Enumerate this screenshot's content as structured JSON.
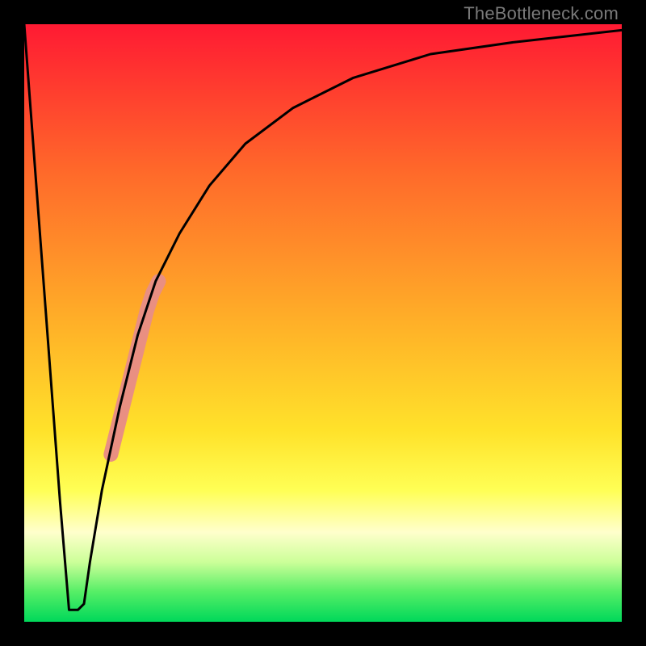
{
  "watermark": "TheBottleneck.com",
  "chart_data": {
    "type": "line",
    "title": "",
    "xlabel": "",
    "ylabel": "",
    "xlim": [
      0,
      100
    ],
    "ylim": [
      0,
      100
    ],
    "series": [
      {
        "name": "bottleneck-curve",
        "x": [
          0,
          3,
          6,
          7.5,
          9,
          10,
          11,
          13,
          16,
          19,
          22,
          26,
          31,
          37,
          45,
          55,
          68,
          82,
          100
        ],
        "values": [
          100,
          60,
          20,
          2,
          2,
          3,
          10,
          22,
          36,
          48,
          57,
          65,
          73,
          80,
          86,
          91,
          95,
          97,
          99
        ]
      }
    ],
    "highlight_segment": {
      "name": "marker-band",
      "x": [
        14.5,
        15.5,
        16.5,
        17.5,
        18.5,
        19.5,
        20.5,
        21.5,
        22.5
      ],
      "values": [
        28,
        32,
        36,
        40,
        44,
        48,
        52,
        55,
        57
      ]
    },
    "highlight_dots": {
      "name": "marker-dots",
      "x": [
        14.5,
        16.0,
        17.5
      ],
      "values": [
        28,
        35,
        40
      ]
    }
  }
}
